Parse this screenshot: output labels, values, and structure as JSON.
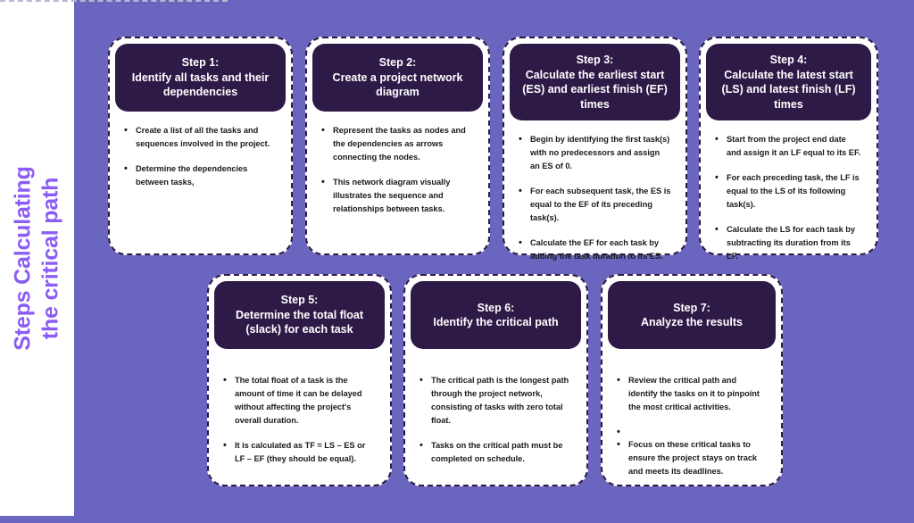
{
  "page": {
    "title": "Steps Calculating the critical path",
    "background_color": "#6A65BE",
    "sidebar_color": "#FFFFFF",
    "card_header_color": "#2E1A47",
    "accent_color": "#8B5CF6",
    "body_text_color": "#1B1B1B"
  },
  "sidebar": {
    "title_line_1": "Steps Calculating",
    "title_line_2": "the critical path"
  },
  "cards": [
    {
      "id": "card-1",
      "step_label": "Step 1:",
      "title_line_1": "Identify all tasks and their",
      "title_line_2": "dependencies",
      "bullets": [
        "Create a list of all the tasks and sequences involved in the project.",
        "Determine the dependencies between tasks,"
      ]
    },
    {
      "id": "card-2",
      "step_label": "Step 2:",
      "title_line_1": "Create a project network",
      "title_line_2": "diagram",
      "bullets": [
        "Represent the tasks as nodes and the dependencies as arrows connecting the nodes.",
        "This network diagram visually illustrates the sequence and relationships between tasks."
      ]
    },
    {
      "id": "card-3",
      "step_label": "Step 3:",
      "title_line_1": "Calculate the earliest start",
      "title_line_2": "(ES) and earliest finish (EF)",
      "title_line_3": "times",
      "bullets": [
        "Begin by identifying the first task(s) with no predecessors and assign an ES of 0.",
        "For each subsequent task, the ES is equal to the EF of its preceding task(s).",
        "Calculate the EF for each task by adding the task duration to its ES."
      ]
    },
    {
      "id": "card-4",
      "step_label": "Step 4:",
      "title_line_1": "Calculate the latest start",
      "title_line_2": "(LS) and latest finish (LF)",
      "title_line_3": "times",
      "bullets": [
        "Start from the project end date and assign it an LF equal to its EF.",
        "For each preceding task, the LF is equal to the LS of its following task(s).",
        "Calculate the LS for each task by subtracting its duration from its LF."
      ]
    },
    {
      "id": "card-5",
      "step_label": "Step 5:",
      "title_line_1": "Determine the total float",
      "title_line_2": "(slack) for each task",
      "bullets": [
        "The total float of a task is the amount of time it can be delayed without affecting the project's overall duration.",
        "It is calculated as TF = LS – ES or LF – EF (they should be equal)."
      ]
    },
    {
      "id": "card-6",
      "step_label": "Step 6:",
      "title_line_1": "Identify the critical path",
      "bullets": [
        "The critical path is the longest path through the project network, consisting of tasks with zero total float.",
        "Tasks on the critical path must be completed on schedule."
      ]
    },
    {
      "id": "card-7",
      "step_label": "Step 7:",
      "title_line_1": "Analyze the results",
      "bullets": [
        "Review the critical path and identify the tasks on it to pinpoint the most critical activities.",
        "",
        "Focus on these critical tasks to ensure the project stays on track and meets its deadlines."
      ]
    }
  ]
}
